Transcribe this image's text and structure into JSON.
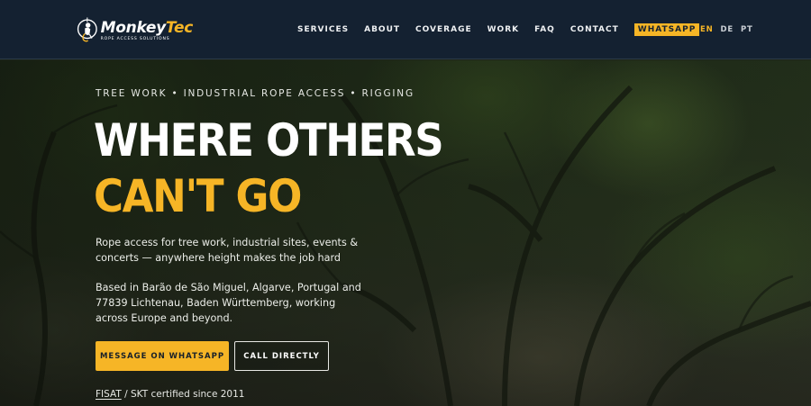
{
  "header": {
    "logo": {
      "name_part1": "Monkey",
      "name_part2": "Tec",
      "tagline": "ROPE ACCESS SOLUTIONS"
    },
    "nav": [
      {
        "label": "SERVICES"
      },
      {
        "label": "ABOUT"
      },
      {
        "label": "COVERAGE"
      },
      {
        "label": "WORK"
      },
      {
        "label": "FAQ"
      },
      {
        "label": "CONTACT"
      }
    ],
    "whatsapp_label": "WHATSAPP",
    "languages": [
      {
        "label": "EN",
        "active": true
      },
      {
        "label": "DE",
        "active": false
      },
      {
        "label": "PT",
        "active": false
      }
    ]
  },
  "hero": {
    "eyebrow": "TREE WORK • INDUSTRIAL ROPE ACCESS • RIGGING",
    "headline_line1": "WHERE OTHERS",
    "headline_line2": "CAN'T GO",
    "lead": "Rope access for tree work, industrial sites, events & concerts — anywhere height makes the job hard",
    "based": "Based in Barão de São Miguel, Algarve, Portugal and 77839 Lichtenau, Baden Württemberg, working across Europe and beyond.",
    "primary_cta": "MESSAGE ON WHATSAPP",
    "secondary_cta": "CALL DIRECTLY",
    "cert_link": "FISAT",
    "cert_rest": " / SKT certified since 2011"
  },
  "colors": {
    "accent": "#f6b526",
    "header_bg": "#142131"
  }
}
